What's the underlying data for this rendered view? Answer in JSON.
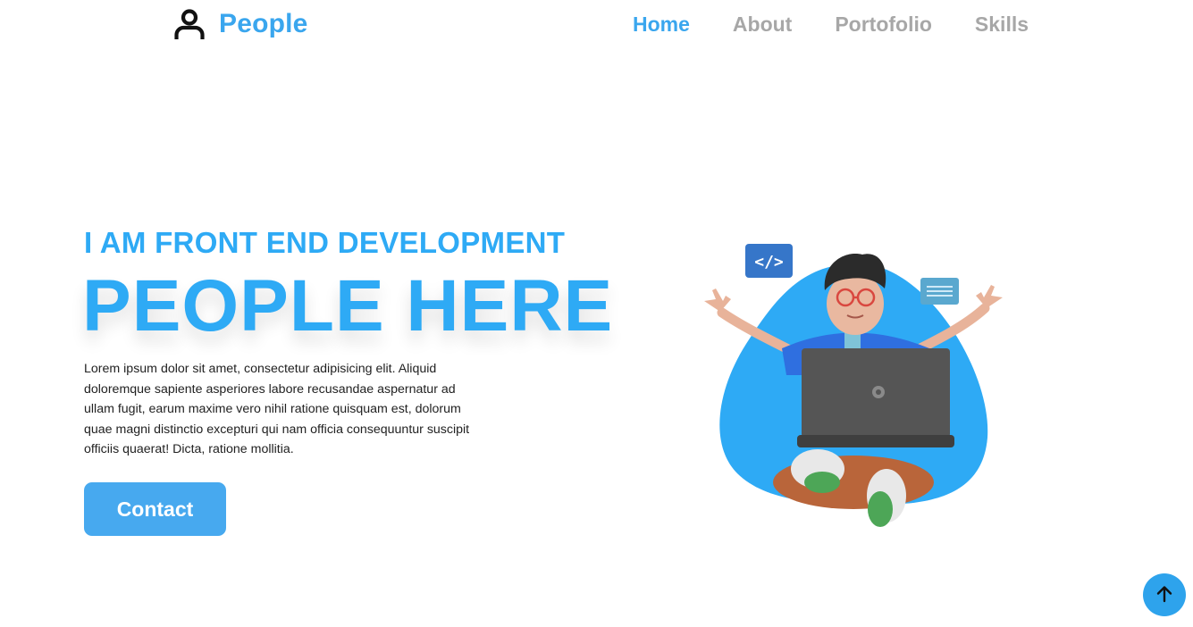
{
  "header": {
    "logo_text": "People",
    "logo_icon": "user-icon",
    "nav": [
      {
        "label": "Home",
        "active": true
      },
      {
        "label": "About",
        "active": false
      },
      {
        "label": "Portofolio",
        "active": false
      },
      {
        "label": "Skills",
        "active": false
      }
    ]
  },
  "hero": {
    "subtitle": "I AM FRONT END DEVELOPMENT",
    "title": "PEOPLE HERE",
    "description": "Lorem ipsum dolor sit amet, consectetur adipisicing elit. Aliquid doloremque sapiente asperiores labore recusandae aspernatur ad ullam fugit, earum maxime vero nihil ratione quisquam est, dolorum quae magni distinctio excepturi qui nam officia consequuntur suscipit officiis quaerat! Dicta, ratione mollitia.",
    "button_label": "Contact",
    "illustration_code_tag": "</>"
  },
  "scroll_top": {
    "icon": "arrow-up-icon"
  },
  "colors": {
    "accent": "#3aa6ee",
    "nav_inactive": "#a7a7a7",
    "blob": "#2eaaf5",
    "button": "#47a9ef"
  }
}
